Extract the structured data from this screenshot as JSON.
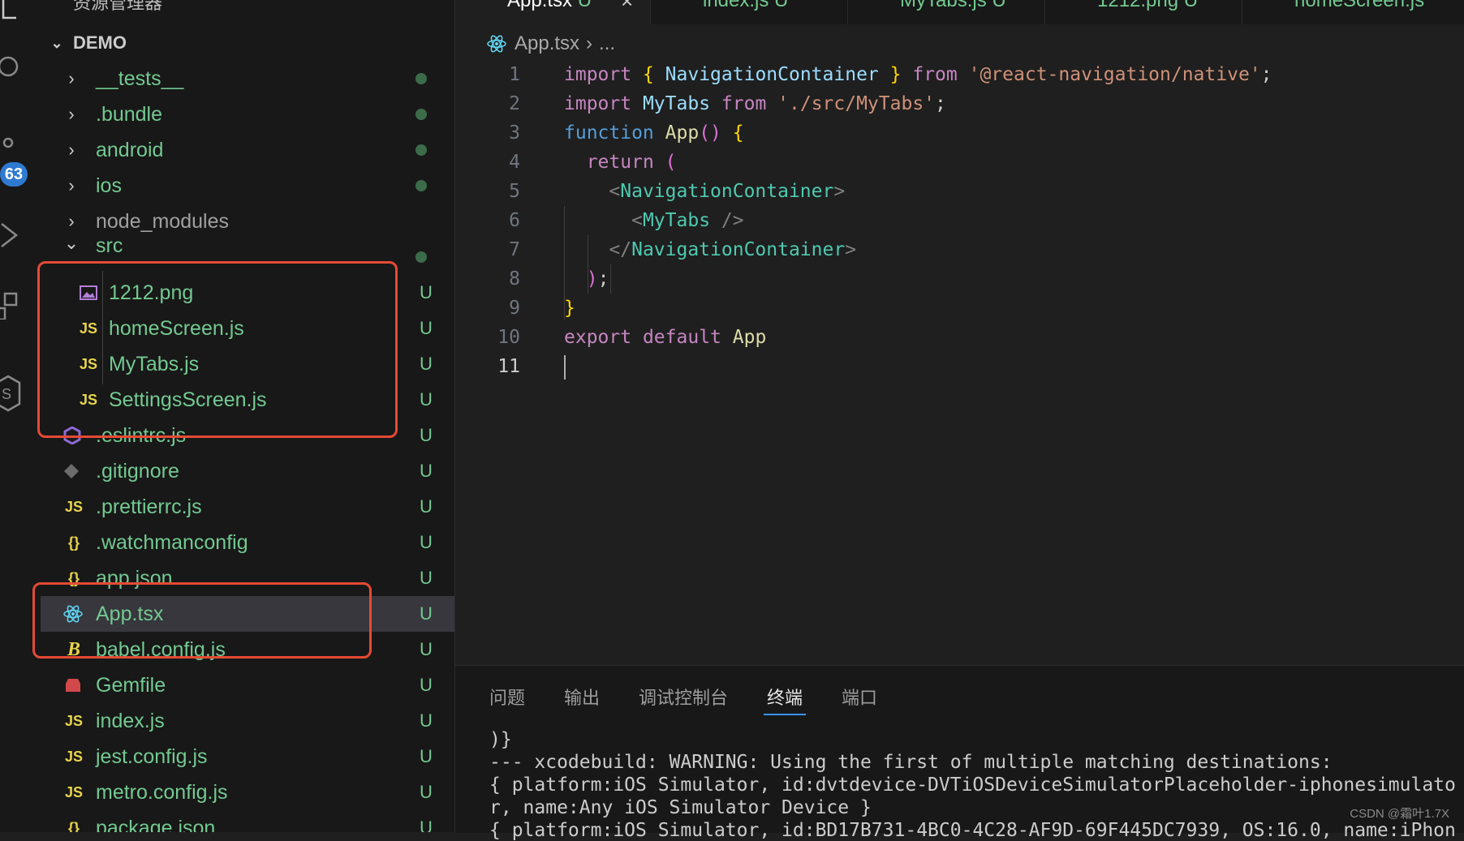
{
  "sidebar": {
    "header": "资源管理器",
    "root": "DEMO",
    "items": [
      {
        "label": "__tests__",
        "status": ""
      },
      {
        "label": ".bundle",
        "status": ""
      },
      {
        "label": "android",
        "status": ""
      },
      {
        "label": "ios",
        "status": ""
      },
      {
        "label": "node_modules",
        "status": ""
      },
      {
        "label": "src",
        "status": ""
      },
      {
        "label": "1212.png",
        "status": "U"
      },
      {
        "label": "homeScreen.js",
        "status": "U"
      },
      {
        "label": "MyTabs.js",
        "status": "U"
      },
      {
        "label": "SettingsScreen.js",
        "status": "U"
      },
      {
        "label": ".eslintrc.js",
        "status": "U"
      },
      {
        "label": ".gitignore",
        "status": "U"
      },
      {
        "label": ".prettierrc.js",
        "status": "U"
      },
      {
        "label": ".watchmanconfig",
        "status": "U"
      },
      {
        "label": "app.json",
        "status": "U"
      },
      {
        "label": "App.tsx",
        "status": "U"
      },
      {
        "label": "babel.config.js",
        "status": "U"
      },
      {
        "label": "Gemfile",
        "status": "U"
      },
      {
        "label": "index.js",
        "status": "U"
      },
      {
        "label": "jest.config.js",
        "status": "U"
      },
      {
        "label": "metro.config.js",
        "status": "U"
      },
      {
        "label": "package.json",
        "status": "U"
      }
    ],
    "icons": {
      "js": "JS",
      "json": "{}",
      "babel": "B"
    }
  },
  "activity": {
    "badge": "63"
  },
  "tabs": [
    {
      "label": "App.tsx",
      "status": "U"
    },
    {
      "label": "index.js",
      "status": "U"
    },
    {
      "label": "MyTabs.js",
      "status": "U"
    },
    {
      "label": "1212.png",
      "status": "U"
    },
    {
      "label": "homeScreen.js"
    }
  ],
  "breadcrumb": {
    "file": "App.tsx",
    "sep": "›",
    "more": "..."
  },
  "editor": {
    "line_numbers": [
      "1",
      "2",
      "3",
      "4",
      "5",
      "6",
      "7",
      "8",
      "9",
      "10",
      "11"
    ],
    "lines": {
      "l1": {
        "import": "import",
        "ob": "{",
        "name": "NavigationContainer",
        "cb": "}",
        "from": "from",
        "str": "'@react-navigation/native'",
        "semi": ";"
      },
      "l2": {
        "import": "import",
        "name": "MyTabs",
        "from": "from",
        "str": "'./src/MyTabs'",
        "semi": ";"
      },
      "l3": {
        "function": "function",
        "name": "App",
        "paren": "()",
        "brace": "{"
      },
      "l4": {
        "return": "return",
        "paren": "("
      },
      "l5": {
        "open": "<",
        "tag": "NavigationContainer",
        "close": ">"
      },
      "l6": {
        "open": "<",
        "tag": "MyTabs",
        "close": " />"
      },
      "l7": {
        "open": "</",
        "tag": "NavigationContainer",
        "close": ">"
      },
      "l8": {
        "paren": ")",
        "semi": ";"
      },
      "l9": {
        "brace": "}"
      },
      "l10": {
        "export": "export",
        "default": "default",
        "name": "App"
      }
    }
  },
  "panel": {
    "tabs": [
      "问题",
      "输出",
      "调试控制台",
      "终端",
      "端口"
    ],
    "active_tab": "终端",
    "terminal_lines": [
      ")}",
      "--- xcodebuild: WARNING: Using the first of multiple matching destinations:",
      "{ platform:iOS Simulator, id:dvtdevice-DVTiOSDeviceSimulatorPlaceholder-iphonesimulato",
      "r, name:Any iOS Simulator Device }",
      "{ platform:iOS Simulator, id:BD17B731-4BC0-4C28-AF9D-69F445DC7939, OS:16.0, name:iPhon"
    ]
  },
  "watermark": "CSDN @霜叶1.7X",
  "colors": {
    "accent": "#3794ff",
    "untracked": "#73c991",
    "highlight_box": "#e64a35"
  }
}
